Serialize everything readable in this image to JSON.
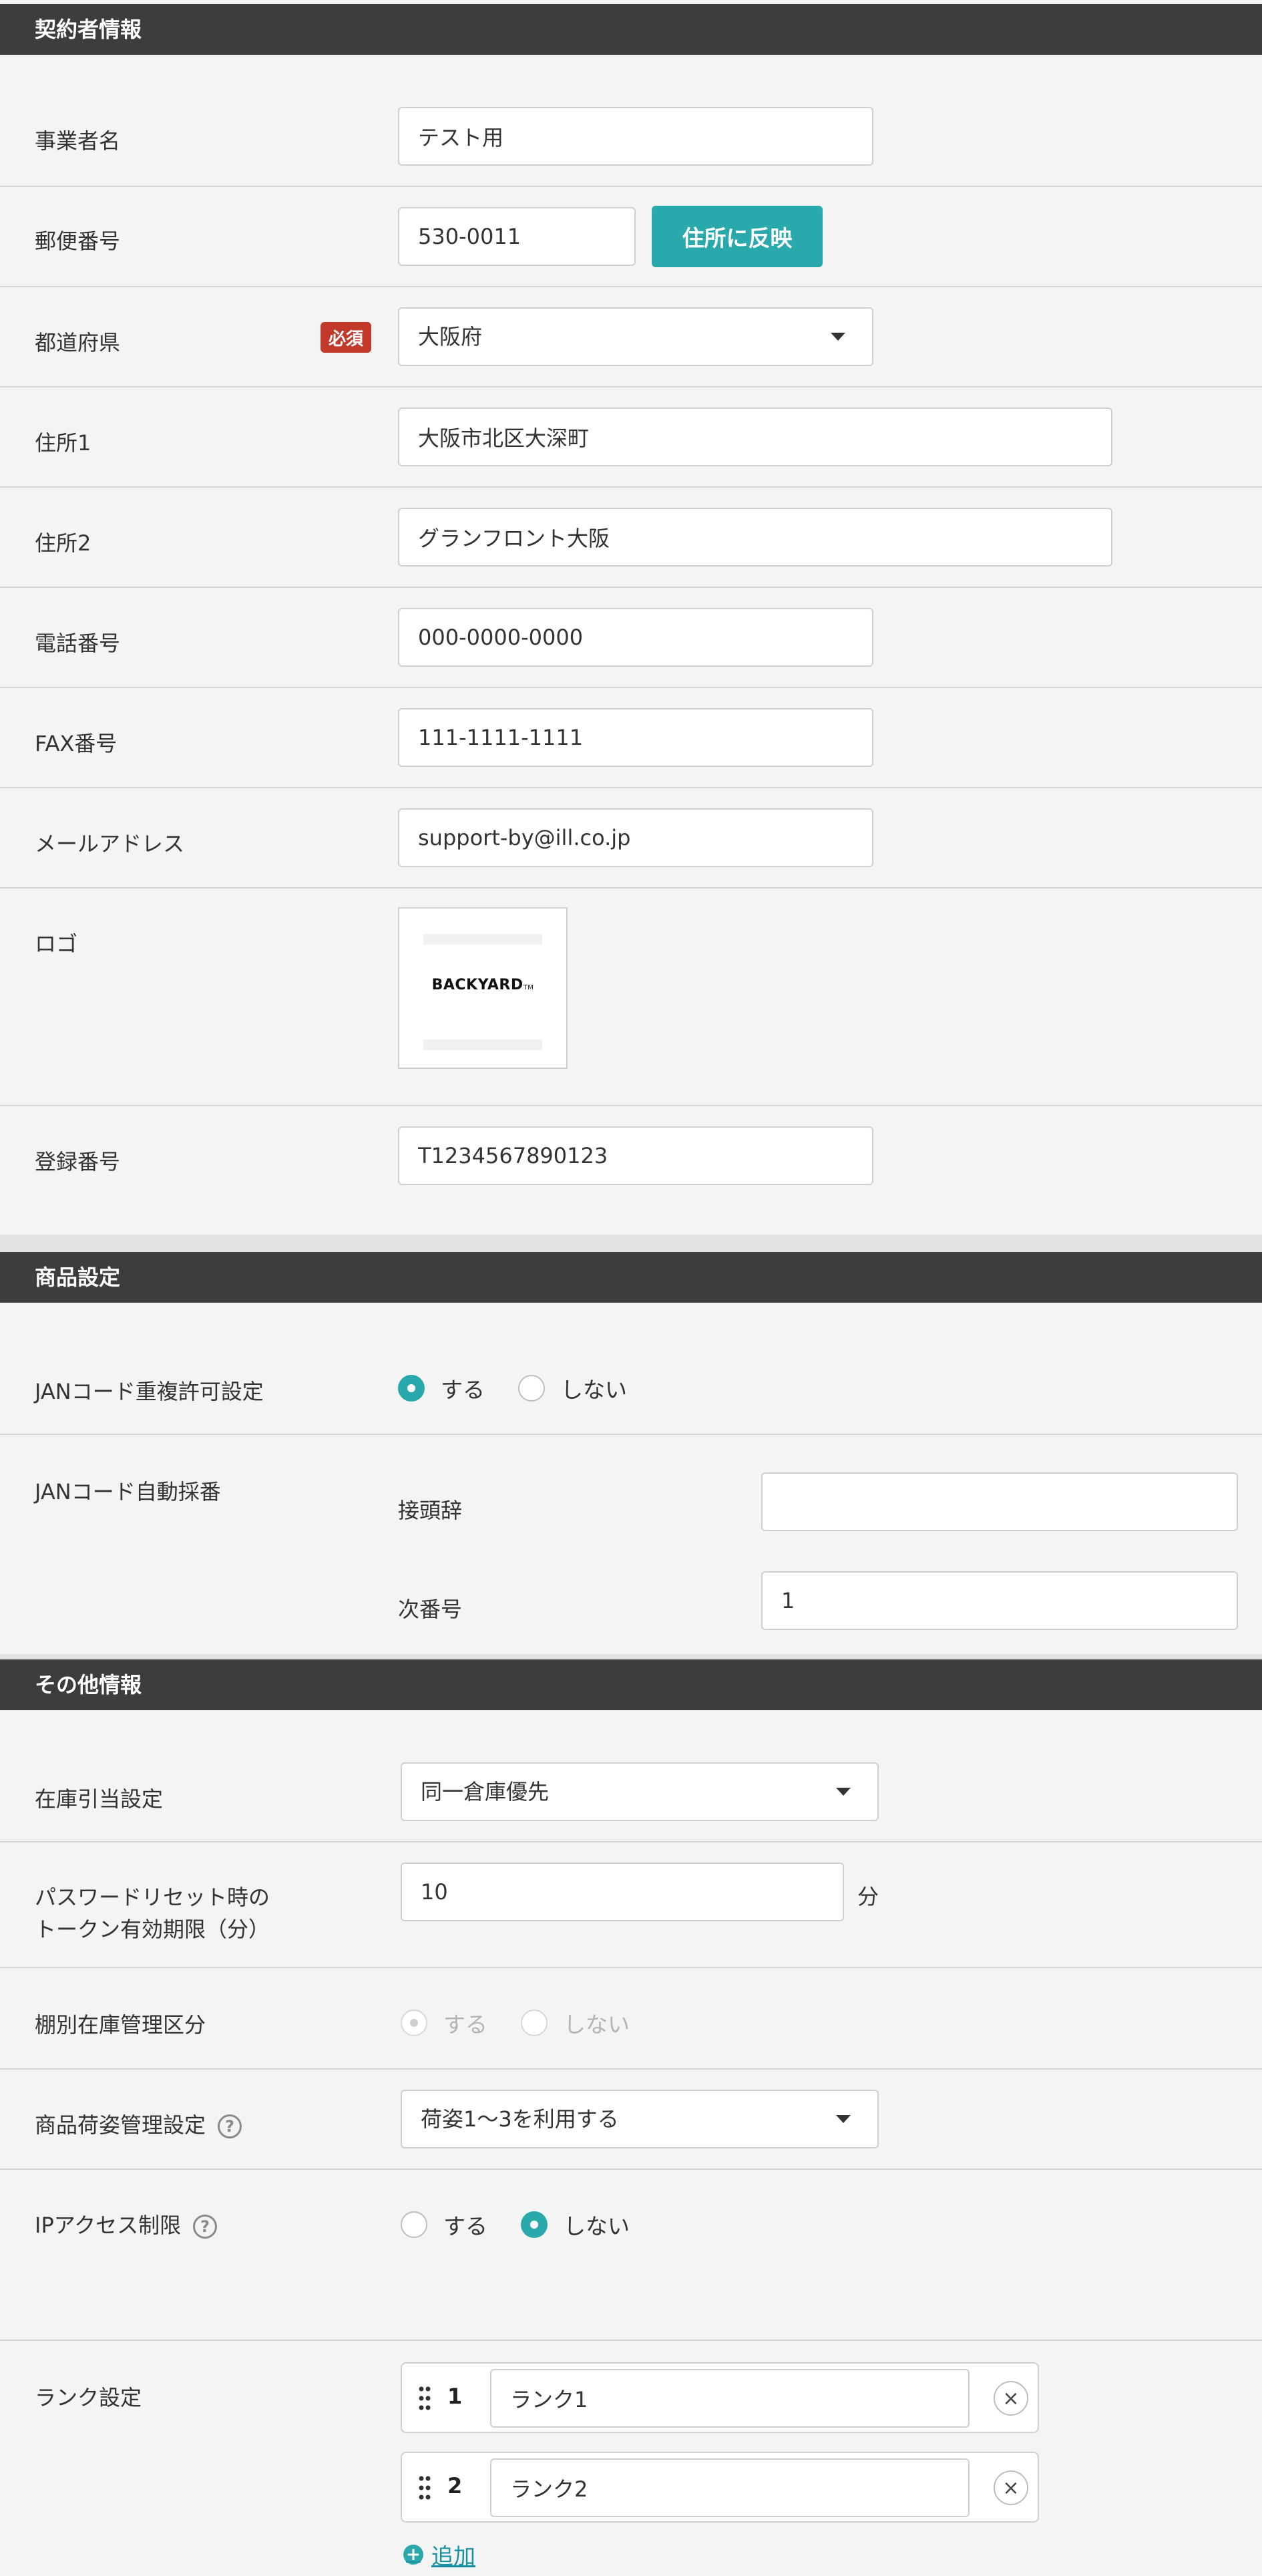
{
  "contractor": {
    "header": "契約者情報",
    "business_name": {
      "label": "事業者名",
      "value": "テスト用"
    },
    "postal": {
      "label": "郵便番号",
      "value": "530-0011",
      "button": "住所に反映"
    },
    "prefecture": {
      "label": "都道府県",
      "required": "必須",
      "value": "大阪府"
    },
    "address1": {
      "label": "住所1",
      "value": "大阪市北区大深町"
    },
    "address2": {
      "label": "住所2",
      "value": "グランフロント大阪"
    },
    "phone": {
      "label": "電話番号",
      "value": "000-0000-0000"
    },
    "fax": {
      "label": "FAX番号",
      "value": "111-1111-1111"
    },
    "email": {
      "label": "メールアドレス",
      "value": "support-by@ill.co.jp"
    },
    "logo": {
      "label": "ロゴ",
      "text": "BACKYARD",
      "mark": "TM"
    },
    "registration": {
      "label": "登録番号",
      "value": "T1234567890123"
    }
  },
  "product": {
    "header": "商品設定",
    "jan_dup": {
      "label": "JANコード重複許可設定",
      "opt_yes": "する",
      "opt_no": "しない",
      "selected": "yes"
    },
    "jan_auto": {
      "label": "JANコード自動採番",
      "prefix_label": "接頭辞",
      "prefix_value": "",
      "next_label": "次番号",
      "next_value": "1"
    }
  },
  "other": {
    "header": "その他情報",
    "stock_alloc": {
      "label": "在庫引当設定",
      "value": "同一倉庫優先"
    },
    "pw_reset": {
      "label_line1": "パスワードリセット時の",
      "label_line2": "トークン有効期限（分）",
      "value": "10",
      "unit": "分"
    },
    "shelf_stock": {
      "label": "棚別在庫管理区分",
      "opt_yes": "する",
      "opt_no": "しない",
      "selected": "yes"
    },
    "packing": {
      "label": "商品荷姿管理設定",
      "value": "荷姿1～3を利用する"
    },
    "ip_restrict": {
      "label": "IPアクセス制限",
      "opt_yes": "する",
      "opt_no": "しない",
      "selected": "no"
    },
    "rank": {
      "label": "ランク設定",
      "items": [
        {
          "num": "1",
          "value": "ランク1"
        },
        {
          "num": "2",
          "value": "ランク2"
        }
      ],
      "add_label": "追加"
    }
  },
  "icons": {
    "help": "?",
    "close": "×",
    "plus": "+"
  }
}
